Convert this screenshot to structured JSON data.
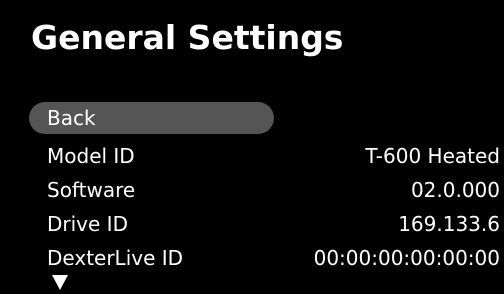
{
  "screen": {
    "title": "General Settings"
  },
  "back_button": {
    "label": "Back"
  },
  "info_rows": [
    {
      "label": "Model ID",
      "value": "T-600 Heated"
    },
    {
      "label": "Software",
      "value": "02.0.000"
    },
    {
      "label": "Drive ID",
      "value": "169.133.6"
    },
    {
      "label": "DexterLive ID",
      "value": "00:00:00:00:00:00"
    }
  ],
  "scroll_indicator": {
    "icon": "down-triangle-icon"
  },
  "colors": {
    "background": "#000000",
    "text": "#ffffff",
    "selection_highlight": "#555555"
  }
}
